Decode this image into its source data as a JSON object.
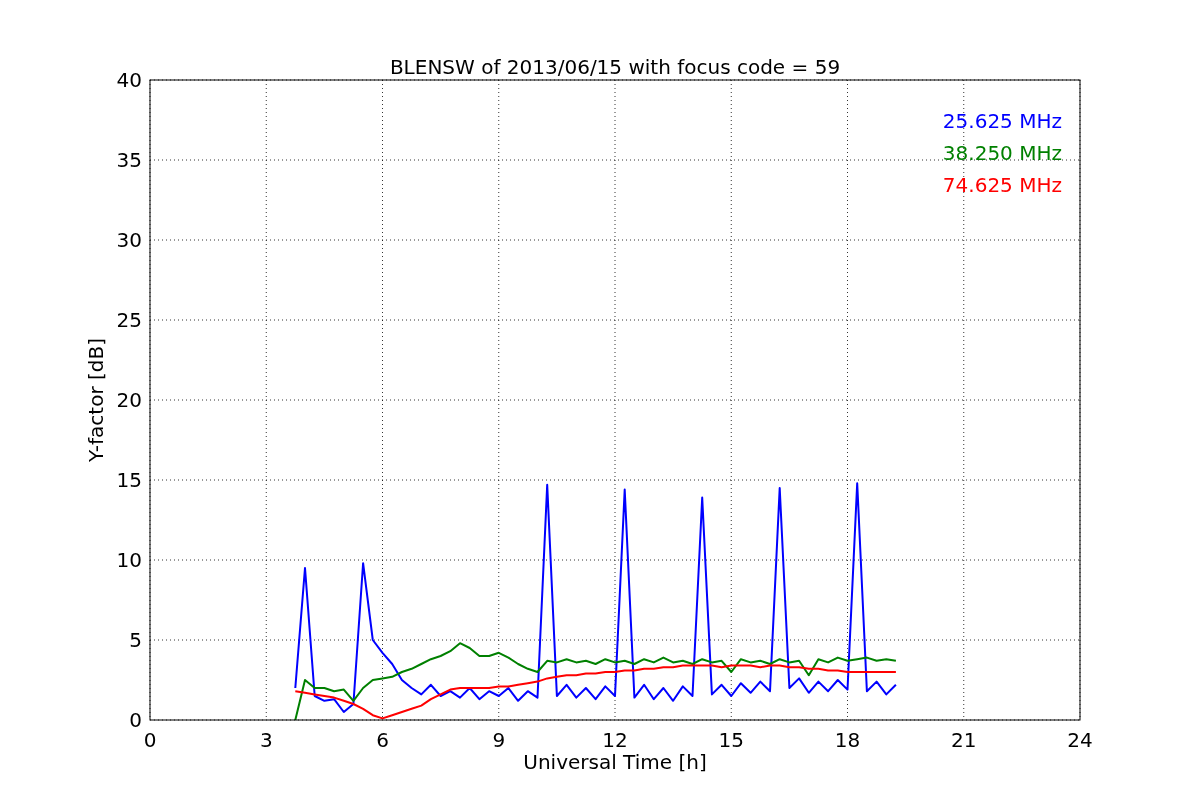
{
  "figure": {
    "chart_data": {
      "type": "line",
      "title": "BLENSW of 2013/06/15 with focus code = 59",
      "xlabel": "Universal Time [h]",
      "ylabel": "Y-factor [dB]",
      "xlim": [
        0,
        24
      ],
      "ylim": [
        0,
        40
      ],
      "grid": true,
      "xticks": [
        0,
        3,
        6,
        9,
        12,
        15,
        18,
        21,
        24
      ],
      "yticks": [
        0,
        5,
        10,
        15,
        20,
        25,
        30,
        35,
        40
      ],
      "x": [
        3.75,
        4.0,
        4.25,
        4.5,
        4.75,
        5.0,
        5.25,
        5.5,
        5.75,
        6.0,
        6.25,
        6.5,
        6.75,
        7.0,
        7.25,
        7.5,
        7.75,
        8.0,
        8.25,
        8.5,
        8.75,
        9.0,
        9.25,
        9.5,
        9.75,
        10.0,
        10.25,
        10.5,
        10.75,
        11.0,
        11.25,
        11.5,
        11.75,
        12.0,
        12.25,
        12.5,
        12.75,
        13.0,
        13.25,
        13.5,
        13.75,
        14.0,
        14.25,
        14.5,
        14.75,
        15.0,
        15.25,
        15.5,
        15.75,
        16.0,
        16.25,
        16.5,
        16.75,
        17.0,
        17.25,
        17.5,
        17.75,
        18.0,
        18.25,
        18.5,
        18.75,
        19.0,
        19.25
      ],
      "series": [
        {
          "name": "25.625 MHz",
          "color": "#0000ff",
          "values": [
            2.0,
            9.5,
            1.5,
            1.2,
            1.3,
            0.5,
            1.0,
            9.8,
            5.0,
            4.2,
            3.5,
            2.5,
            2.0,
            1.6,
            2.2,
            1.5,
            1.8,
            1.4,
            2.0,
            1.3,
            1.8,
            1.5,
            2.0,
            1.2,
            1.8,
            1.4,
            14.7,
            1.5,
            2.2,
            1.4,
            2.0,
            1.3,
            2.1,
            1.5,
            14.4,
            1.4,
            2.2,
            1.3,
            2.0,
            1.2,
            2.1,
            1.5,
            13.9,
            1.6,
            2.2,
            1.5,
            2.3,
            1.7,
            2.4,
            1.8,
            14.5,
            2.0,
            2.6,
            1.7,
            2.4,
            1.8,
            2.5,
            1.9,
            14.8,
            1.8,
            2.4,
            1.6,
            2.2
          ]
        },
        {
          "name": "38.250 MHz",
          "color": "#008000",
          "values": [
            0.0,
            2.5,
            2.0,
            2.0,
            1.8,
            1.9,
            1.2,
            2.0,
            2.5,
            2.6,
            2.7,
            3.0,
            3.2,
            3.5,
            3.8,
            4.0,
            4.3,
            4.8,
            4.5,
            4.0,
            4.0,
            4.2,
            3.9,
            3.5,
            3.2,
            3.0,
            3.7,
            3.6,
            3.8,
            3.6,
            3.7,
            3.5,
            3.8,
            3.6,
            3.7,
            3.5,
            3.8,
            3.6,
            3.9,
            3.6,
            3.7,
            3.5,
            3.8,
            3.6,
            3.7,
            3.0,
            3.8,
            3.6,
            3.7,
            3.5,
            3.8,
            3.6,
            3.7,
            2.8,
            3.8,
            3.6,
            3.9,
            3.7,
            3.8,
            3.9,
            3.7,
            3.8,
            3.7
          ]
        },
        {
          "name": "74.625 MHz",
          "color": "#ff0000",
          "values": [
            1.8,
            1.7,
            1.6,
            1.5,
            1.4,
            1.2,
            1.0,
            0.7,
            0.3,
            0.1,
            0.3,
            0.5,
            0.7,
            0.9,
            1.3,
            1.6,
            1.9,
            2.0,
            2.0,
            2.0,
            2.0,
            2.1,
            2.1,
            2.2,
            2.3,
            2.4,
            2.6,
            2.7,
            2.8,
            2.8,
            2.9,
            2.9,
            3.0,
            3.0,
            3.1,
            3.1,
            3.2,
            3.2,
            3.3,
            3.3,
            3.4,
            3.4,
            3.4,
            3.4,
            3.3,
            3.4,
            3.4,
            3.4,
            3.3,
            3.4,
            3.4,
            3.3,
            3.3,
            3.2,
            3.2,
            3.1,
            3.1,
            3.0,
            3.0,
            3.0,
            3.0,
            3.0,
            3.0
          ]
        }
      ]
    }
  }
}
